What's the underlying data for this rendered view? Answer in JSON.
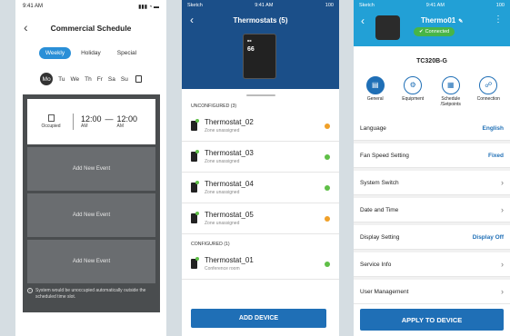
{
  "phone1": {
    "status_time": "9:41 AM",
    "status_icons": "▮▮▮ ◔ ▬",
    "title": "Commercial Schedule",
    "tabs": [
      "Weekly",
      "Holiday",
      "Special"
    ],
    "days": [
      "Mo",
      "Tu",
      "We",
      "Th",
      "Fr",
      "Sa",
      "Su"
    ],
    "event": {
      "mode": "Occupied",
      "start": "12:00",
      "start_ampm": "AM",
      "dash": "—",
      "end": "12:00",
      "end_ampm": "AM"
    },
    "add_event_label": "Add New Event",
    "note": "System would be unoccupied automatically outside the scheduled time slot."
  },
  "phone2": {
    "status_left": "Sketch",
    "status_time": "9:41 AM",
    "status_right": "100",
    "title": "Thermostats (5)",
    "device_display_value": "66",
    "unconfigured_header": "UNCONFIGURED (3)",
    "unconfigured": [
      {
        "name": "Thermostat_02",
        "zone": "Zone unassigned",
        "status": "orange"
      },
      {
        "name": "Thermostat_03",
        "zone": "Zone unassigned",
        "status": "green"
      },
      {
        "name": "Thermostat_04",
        "zone": "Zone unassigned",
        "status": "green"
      },
      {
        "name": "Thermostat_05",
        "zone": "Zone unassigned",
        "status": "orange"
      }
    ],
    "configured_header": "CONFIGURED (1)",
    "configured": [
      {
        "name": "Thermostat_01",
        "zone": "Conference room",
        "status": "green"
      }
    ],
    "add_device_label": "ADD DEVICE"
  },
  "phone3": {
    "status_left": "Sketch",
    "status_time": "9:41 AM",
    "status_right": "100",
    "device_name": "Thermo01",
    "connected_label": "Connected",
    "model": "TC320B-G",
    "categories": [
      "General",
      "Equipment",
      "Schedule /Setpoints",
      "Connection"
    ],
    "settings": [
      {
        "label": "Language",
        "value": "English"
      },
      {
        "label": "Fan Speed Setting",
        "value": "Fixed"
      },
      {
        "label": "System Switch",
        "value": ""
      },
      {
        "label": "Date and Time",
        "value": ""
      },
      {
        "label": "Display Setting",
        "value": "Display Off"
      },
      {
        "label": "Service Info",
        "value": ""
      },
      {
        "label": "User Management",
        "value": ""
      }
    ],
    "apply_label": "APPLY TO DEVICE"
  },
  "colors": {
    "accent_blue": "#1f6fb6",
    "header_navy": "#1b4f89",
    "header_cyan": "#22a0d6",
    "status_green": "#5fbf47",
    "status_orange": "#f0a028"
  }
}
